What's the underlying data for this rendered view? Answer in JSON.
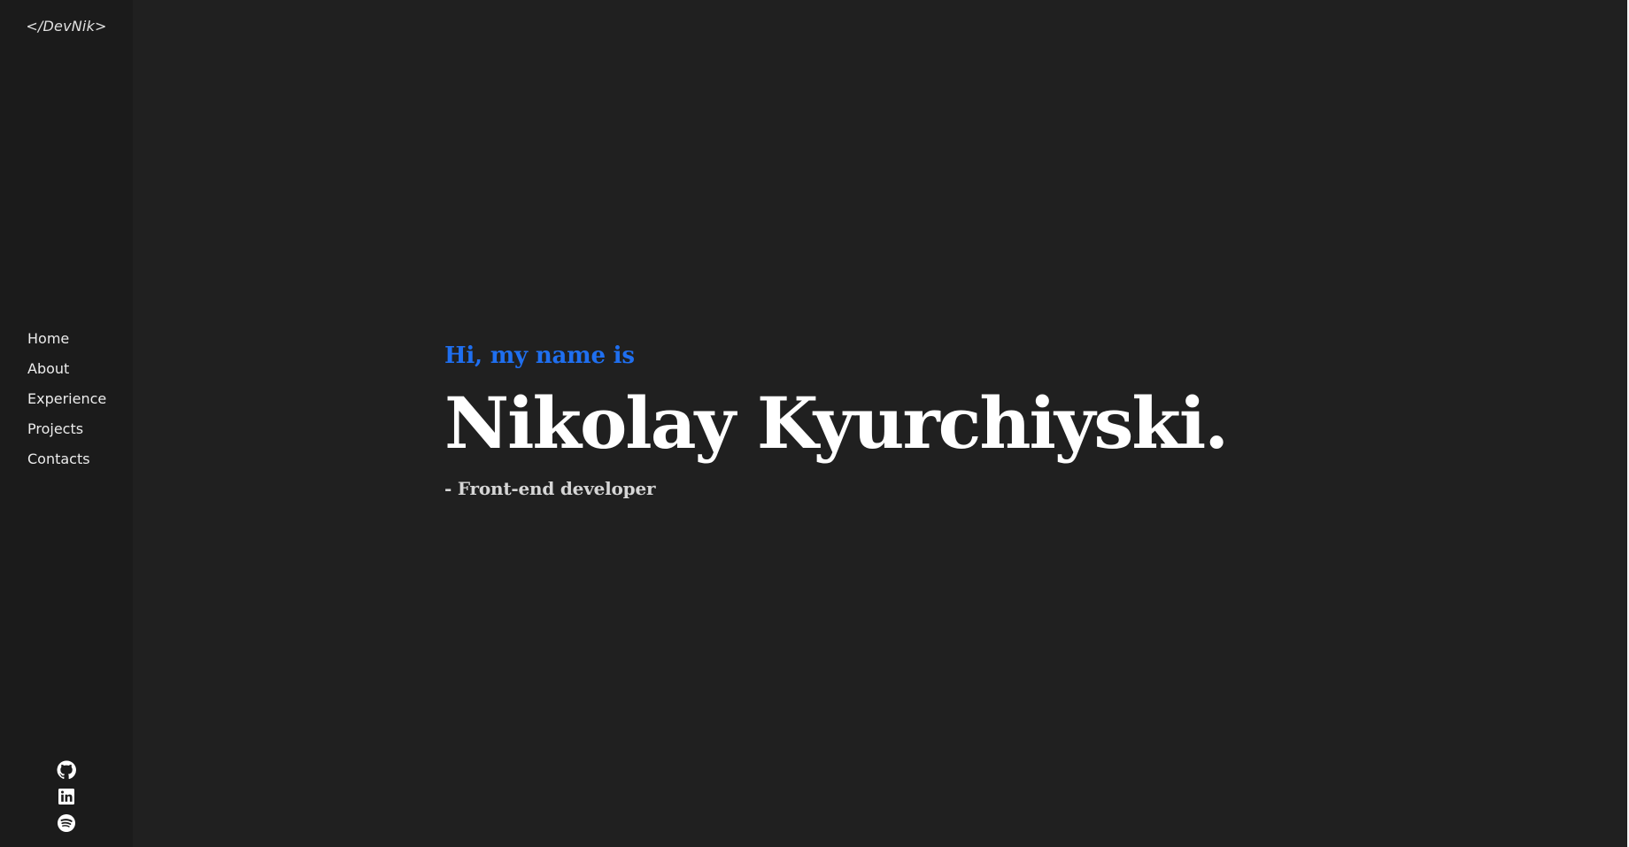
{
  "sidebar": {
    "logo": "</DevNik>",
    "nav": [
      {
        "label": "Home"
      },
      {
        "label": "About"
      },
      {
        "label": "Experience"
      },
      {
        "label": "Projects"
      },
      {
        "label": "Contacts"
      }
    ],
    "socials": [
      {
        "icon": "github-icon"
      },
      {
        "icon": "linkedin-icon"
      },
      {
        "icon": "spotify-icon"
      }
    ]
  },
  "hero": {
    "greeting": "Hi, my name is",
    "name": "Nikolay Kyurchiyski.",
    "role": "- Front-end developer"
  },
  "colors": {
    "background": "#202020",
    "sidebar": "#1b1b1b",
    "accent": "#1f6ff0",
    "text": "#ffffff"
  }
}
